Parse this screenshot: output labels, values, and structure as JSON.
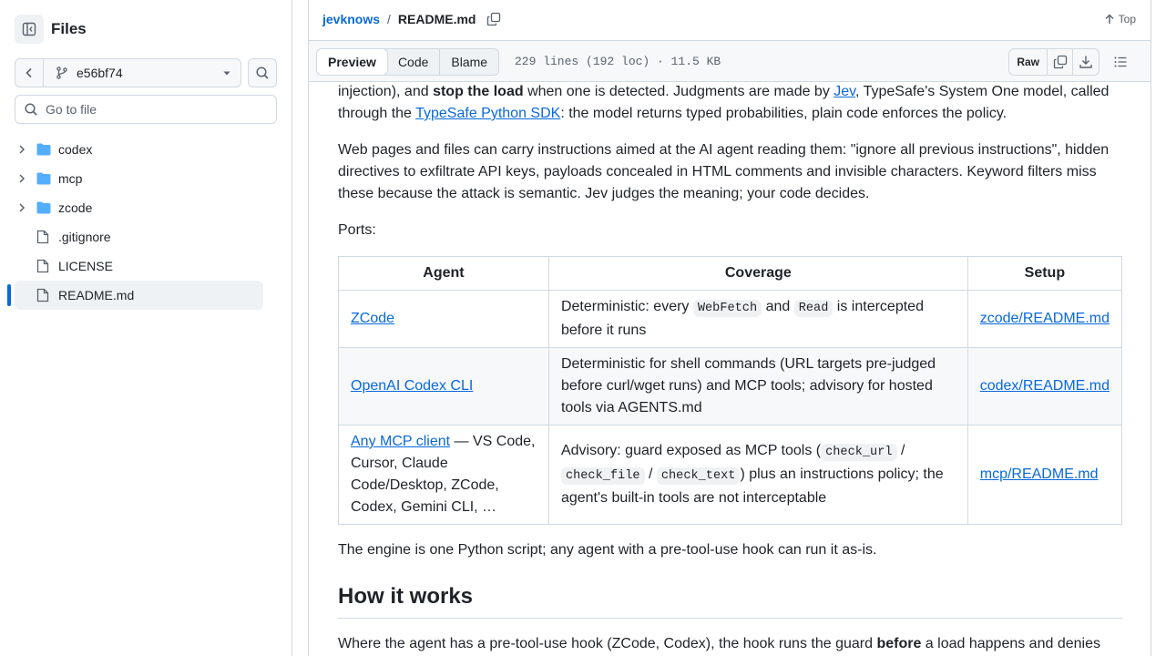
{
  "sidebar": {
    "title": "Files",
    "branch": "e56bf74",
    "goto_placeholder": "Go to file",
    "items": [
      {
        "label": "codex",
        "type": "folder"
      },
      {
        "label": "mcp",
        "type": "folder"
      },
      {
        "label": "zcode",
        "type": "folder"
      },
      {
        "label": ".gitignore",
        "type": "file"
      },
      {
        "label": "LICENSE",
        "type": "file"
      },
      {
        "label": "README.md",
        "type": "file",
        "selected": true
      }
    ]
  },
  "header": {
    "repo": "jevknows",
    "separator": "/",
    "file": "README.md",
    "top_label": "Top"
  },
  "toolbar": {
    "tabs": [
      "Preview",
      "Code",
      "Blame"
    ],
    "active_tab": "Preview",
    "meta": "229 lines (192 loc) · 11.5 KB",
    "raw_label": "Raw"
  },
  "content": {
    "p1": {
      "a": "injection), and ",
      "b": "stop the load",
      "c": " when one is detected. Judgments are made by ",
      "link1": "Jev",
      "d": ", TypeSafe's System One model, called through the ",
      "link2": "TypeSafe Python SDK",
      "e": ": the model returns typed probabilities, plain code enforces the policy."
    },
    "p2": "Web pages and files can carry instructions aimed at the AI agent reading them: \"ignore all previous instructions\", hidden directives to exfiltrate API keys, payloads concealed in HTML comments and invisible characters. Keyword filters miss these because the attack is semantic. Jev judges the meaning; your code decides.",
    "p3": "Ports:",
    "table": {
      "headers": [
        "Agent",
        "Coverage",
        "Setup"
      ],
      "row1": {
        "agent": "ZCode",
        "cov_a": "Deterministic: every ",
        "code1": "WebFetch",
        "cov_b": " and ",
        "code2": "Read",
        "cov_c": " is intercepted before it runs",
        "setup": "zcode/README.md"
      },
      "row2": {
        "agent": "OpenAI Codex CLI",
        "coverage": "Deterministic for shell commands (URL targets pre-judged before curl/wget runs) and MCP tools; advisory for hosted tools via AGENTS.md",
        "setup": "codex/README.md"
      },
      "row3": {
        "agent_link": "Any MCP client",
        "agent_rest": " — VS Code, Cursor, Claude Code/Desktop, ZCode, Codex, Gemini CLI, …",
        "cov_a": "Advisory: guard exposed as MCP tools (",
        "code1": "check_url",
        "sep1": " / ",
        "code2": "check_file",
        "sep2": " / ",
        "code3": "check_text",
        "cov_b": ") plus an instructions policy; the agent's built-in tools are not interceptable",
        "setup": "mcp/README.md"
      }
    },
    "p4": "The engine is one Python script; any agent with a pre-tool-use hook can run it as-is.",
    "h2": "How it works",
    "p5": {
      "a": "Where the agent has a pre-tool-use hook (ZCode, Codex), the hook runs the guard ",
      "b": "before",
      "c": " a load happens and denies"
    }
  }
}
